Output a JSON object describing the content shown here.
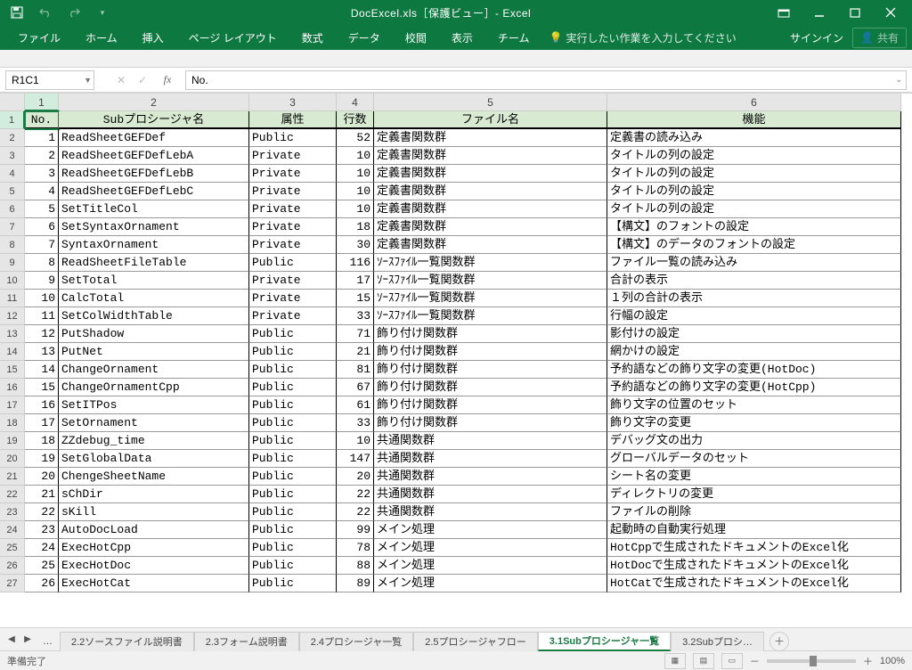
{
  "titlebar": {
    "title": "DocExcel.xls［保護ビュー］- Excel"
  },
  "ribbon": {
    "tabs": [
      "ファイル",
      "ホーム",
      "挿入",
      "ページ レイアウト",
      "数式",
      "データ",
      "校閲",
      "表示",
      "チーム"
    ],
    "tellme": "実行したい作業を入力してください",
    "signin": "サインイン",
    "share": "共有"
  },
  "fxbar": {
    "namebox": "R1C1",
    "formula": "No."
  },
  "columns": [
    "1",
    "2",
    "3",
    "4",
    "5",
    "6"
  ],
  "headers": [
    "No.",
    "Subプロシージャ名",
    "属性",
    "行数",
    "ファイル名",
    "機能"
  ],
  "rows": [
    {
      "n": 1,
      "name": "ReadSheetGEFDef",
      "attr": "Public",
      "lines": 52,
      "file": "定義書関数群",
      "func": "定義書の読み込み"
    },
    {
      "n": 2,
      "name": "ReadSheetGEFDefLebA",
      "attr": "Private",
      "lines": 10,
      "file": "定義書関数群",
      "func": "タイトルの列の設定"
    },
    {
      "n": 3,
      "name": "ReadSheetGEFDefLebB",
      "attr": "Private",
      "lines": 10,
      "file": "定義書関数群",
      "func": "タイトルの列の設定"
    },
    {
      "n": 4,
      "name": "ReadSheetGEFDefLebC",
      "attr": "Private",
      "lines": 10,
      "file": "定義書関数群",
      "func": "タイトルの列の設定"
    },
    {
      "n": 5,
      "name": "SetTitleCol",
      "attr": "Private",
      "lines": 10,
      "file": "定義書関数群",
      "func": "タイトルの列の設定"
    },
    {
      "n": 6,
      "name": "SetSyntaxOrnament",
      "attr": "Private",
      "lines": 18,
      "file": "定義書関数群",
      "func": "【構文】のフォントの設定"
    },
    {
      "n": 7,
      "name": "SyntaxOrnament",
      "attr": "Private",
      "lines": 30,
      "file": "定義書関数群",
      "func": "【構文】のデータのフォントの設定"
    },
    {
      "n": 8,
      "name": "ReadSheetFileTable",
      "attr": "Public",
      "lines": 116,
      "file": "ｿｰｽﾌｧｲﾙ一覧関数群",
      "func": "ファイル一覧の読み込み"
    },
    {
      "n": 9,
      "name": "SetTotal",
      "attr": "Private",
      "lines": 17,
      "file": "ｿｰｽﾌｧｲﾙ一覧関数群",
      "func": "合計の表示"
    },
    {
      "n": 10,
      "name": "CalcTotal",
      "attr": "Private",
      "lines": 15,
      "file": "ｿｰｽﾌｧｲﾙ一覧関数群",
      "func": "１列の合計の表示"
    },
    {
      "n": 11,
      "name": "SetColWidthTable",
      "attr": "Private",
      "lines": 33,
      "file": "ｿｰｽﾌｧｲﾙ一覧関数群",
      "func": "行幅の設定"
    },
    {
      "n": 12,
      "name": "PutShadow",
      "attr": "Public",
      "lines": 71,
      "file": "飾り付け関数群",
      "func": "影付けの設定"
    },
    {
      "n": 13,
      "name": "PutNet",
      "attr": "Public",
      "lines": 21,
      "file": "飾り付け関数群",
      "func": "網かけの設定"
    },
    {
      "n": 14,
      "name": "ChangeOrnament",
      "attr": "Public",
      "lines": 81,
      "file": "飾り付け関数群",
      "func": "予約語などの飾り文字の変更(HotDoc)"
    },
    {
      "n": 15,
      "name": "ChangeOrnamentCpp",
      "attr": "Public",
      "lines": 67,
      "file": "飾り付け関数群",
      "func": "予約語などの飾り文字の変更(HotCpp)"
    },
    {
      "n": 16,
      "name": "SetITPos",
      "attr": "Public",
      "lines": 61,
      "file": "飾り付け関数群",
      "func": "飾り文字の位置のセット"
    },
    {
      "n": 17,
      "name": "SetOrnament",
      "attr": "Public",
      "lines": 33,
      "file": "飾り付け関数群",
      "func": "飾り文字の変更"
    },
    {
      "n": 18,
      "name": "ZZdebug_time",
      "attr": "Public",
      "lines": 10,
      "file": "共通関数群",
      "func": "デバッグ文の出力"
    },
    {
      "n": 19,
      "name": "SetGlobalData",
      "attr": "Public",
      "lines": 147,
      "file": "共通関数群",
      "func": "グローバルデータのセット"
    },
    {
      "n": 20,
      "name": "ChengeSheetName",
      "attr": "Public",
      "lines": 20,
      "file": "共通関数群",
      "func": "シート名の変更"
    },
    {
      "n": 21,
      "name": "sChDir",
      "attr": "Public",
      "lines": 22,
      "file": "共通関数群",
      "func": "ディレクトリの変更"
    },
    {
      "n": 22,
      "name": "sKill",
      "attr": "Public",
      "lines": 22,
      "file": "共通関数群",
      "func": "ファイルの削除"
    },
    {
      "n": 23,
      "name": "AutoDocLoad",
      "attr": "Public",
      "lines": 99,
      "file": "メイン処理",
      "func": "起動時の自動実行処理"
    },
    {
      "n": 24,
      "name": "ExecHotCpp",
      "attr": "Public",
      "lines": 78,
      "file": "メイン処理",
      "func": "HotCppで生成されたドキュメントのExcel化"
    },
    {
      "n": 25,
      "name": "ExecHotDoc",
      "attr": "Public",
      "lines": 88,
      "file": "メイン処理",
      "func": "HotDocで生成されたドキュメントのExcel化"
    },
    {
      "n": 26,
      "name": "ExecHotCat",
      "attr": "Public",
      "lines": 89,
      "file": "メイン処理",
      "func": "HotCatで生成されたドキュメントのExcel化"
    }
  ],
  "sheets": {
    "tabs": [
      "2.2ソースファイル説明書",
      "2.3フォーム説明書",
      "2.4プロシージャ一覧",
      "2.5プロシージャフロー",
      "3.1Subプロシージャ一覧",
      "3.2Subプロシ… "
    ],
    "active": 4,
    "dots": "…"
  },
  "status": {
    "ready": "準備完了",
    "zoom": "100%",
    "plus": "＋",
    "minus": "－"
  }
}
